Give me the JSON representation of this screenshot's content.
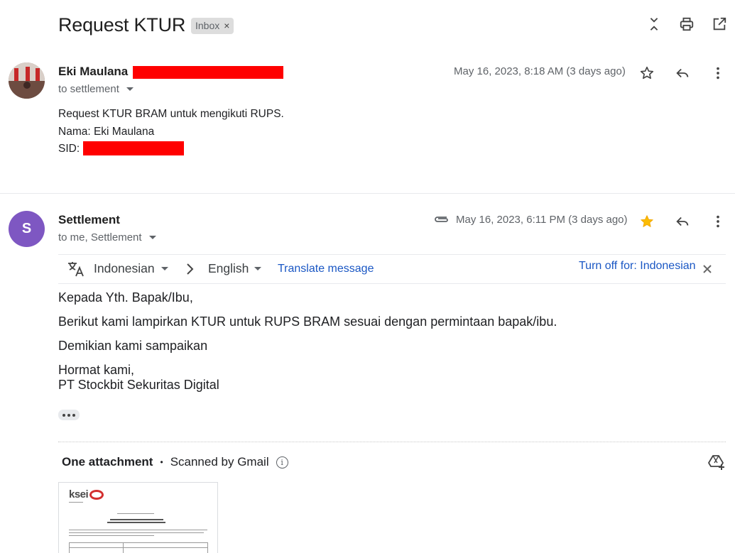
{
  "thread": {
    "subject": "Request KTUR",
    "label": "Inbox",
    "label_remove": "×"
  },
  "toolbar_icons": [
    "collapse-all-icon",
    "print-icon",
    "open-in-new-window-icon"
  ],
  "messages": [
    {
      "sender": "Eki Maulana",
      "recipients": "to settlement",
      "date": "May 16, 2023, 8:18 AM (3 days ago)",
      "starred": false,
      "body": [
        "Request KTUR BRAM untuk mengikuti RUPS.",
        "Nama: Eki Maulana",
        "SID: "
      ]
    },
    {
      "avatar_letter": "S",
      "sender": "Settlement",
      "recipients": "to me, Settlement",
      "date": "May 16, 2023, 6:11 PM (3 days ago)",
      "starred": true,
      "has_attachment": true,
      "translate": {
        "source_lang": "Indonesian",
        "target_lang": "English",
        "translate_label": "Translate message",
        "turn_off_label": "Turn off for: Indonesian"
      },
      "body": [
        "Kepada Yth. Bapak/Ibu,",
        "Berikut kami lampirkan KTUR untuk RUPS BRAM sesuai dengan permintaan bapak/ibu.",
        "Demikian kami sampaikan",
        "Hormat kami,",
        "PT Stockbit Sekuritas Digital"
      ],
      "attachments": {
        "heading": "One attachment",
        "separator": "•",
        "scan_note": "Scanned by Gmail",
        "file_brand": "ksei"
      }
    }
  ],
  "colors": {
    "redaction": "#ff0000",
    "avatar_s": "#7e57c2",
    "link": "#1a57c4",
    "star_active": "#fbbc04"
  }
}
